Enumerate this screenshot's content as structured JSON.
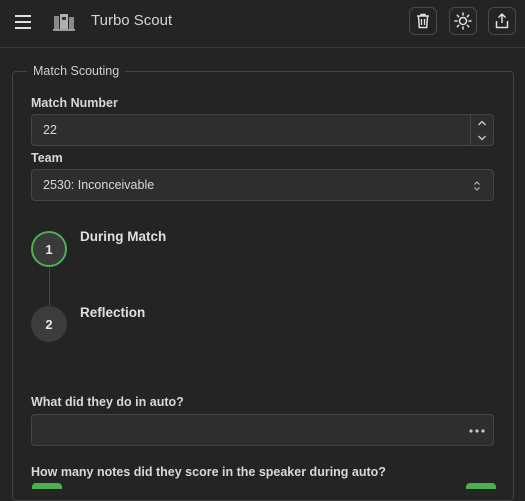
{
  "app": {
    "title": "Turbo Scout"
  },
  "topbar": {
    "menu_icon": "hamburger-menu-icon",
    "logo_icon": "robot-logo-icon",
    "actions": [
      {
        "icon": "trash-icon",
        "name": "delete-button"
      },
      {
        "icon": "sun-icon",
        "name": "theme-toggle-button"
      },
      {
        "icon": "share-icon",
        "name": "share-button"
      }
    ]
  },
  "form": {
    "legend": "Match Scouting",
    "match_number": {
      "label": "Match Number",
      "value": "22"
    },
    "team": {
      "label": "Team",
      "selected": "2530: Inconceivable"
    },
    "steps": [
      {
        "number": "1",
        "label": "During Match",
        "active": true
      },
      {
        "number": "2",
        "label": "Reflection",
        "active": false
      }
    ],
    "auto_question": {
      "label": "What did they do in auto?",
      "value": ""
    },
    "speaker_question": {
      "label": "How many notes did they score in the speaker during auto?"
    }
  },
  "colors": {
    "accent": "#4caf50",
    "background": "#242424",
    "input_bg": "#2e2e2e"
  }
}
